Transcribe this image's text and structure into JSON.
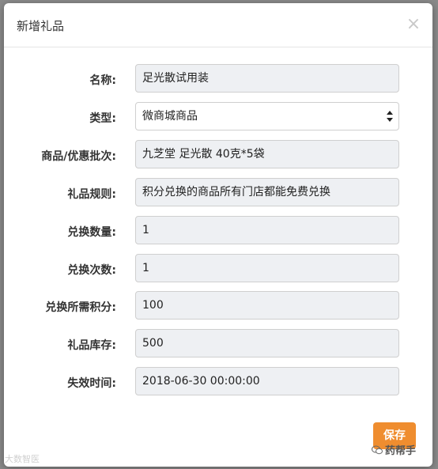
{
  "dialog": {
    "title": "新增礼品",
    "close_glyph": "×"
  },
  "form": {
    "fields": [
      {
        "label": "名称:",
        "value": "足光散试用装",
        "kind": "input"
      },
      {
        "label": "类型:",
        "value": "微商城商品",
        "kind": "select"
      },
      {
        "label": "商品/优惠批次:",
        "value": "九芝堂 足光散 40克*5袋",
        "kind": "input"
      },
      {
        "label": "礼品规则:",
        "value": "积分兑换的商品所有门店都能免费兑换",
        "kind": "input"
      },
      {
        "label": "兑换数量:",
        "value": "1",
        "kind": "input"
      },
      {
        "label": "兑换次数:",
        "value": "1",
        "kind": "input"
      },
      {
        "label": "兑换所需积分:",
        "value": "100",
        "kind": "input"
      },
      {
        "label": "礼品库存:",
        "value": "500",
        "kind": "input"
      },
      {
        "label": "失效时间:",
        "value": "2018-06-30 00:00:00",
        "kind": "input"
      }
    ]
  },
  "footer": {
    "save_label": "保存"
  },
  "watermarks": {
    "left": "大数智医",
    "right": "药帮手"
  },
  "colors": {
    "accent": "#ef8d2f",
    "input_bg": "#eef0f3"
  },
  "icons": {
    "close": "close-icon",
    "select": "select-arrows-icon",
    "wechat": "wechat-icon"
  }
}
